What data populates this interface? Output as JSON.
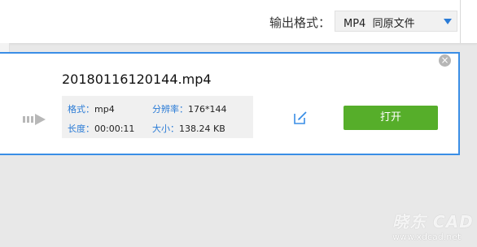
{
  "header": {
    "output_format_label": "输出格式：",
    "output_format_value": "MP4  同原文件"
  },
  "file_card": {
    "filename": "20180116120144.mp4",
    "info": {
      "format_key": "格式：",
      "format_value": "mp4",
      "resolution_key": "分辨率：",
      "resolution_value": "176*144",
      "duration_key": "长度：",
      "duration_value": "00:00:11",
      "size_key": "大小：",
      "size_value": "138.24 KB"
    },
    "open_button_label": "打开",
    "close_glyph": "×"
  },
  "watermark": {
    "brand": "晓东 CAD",
    "url": "www.xdcad.net"
  },
  "colors": {
    "accent_blue": "#3a8ee6",
    "open_green": "#56ae2a"
  }
}
